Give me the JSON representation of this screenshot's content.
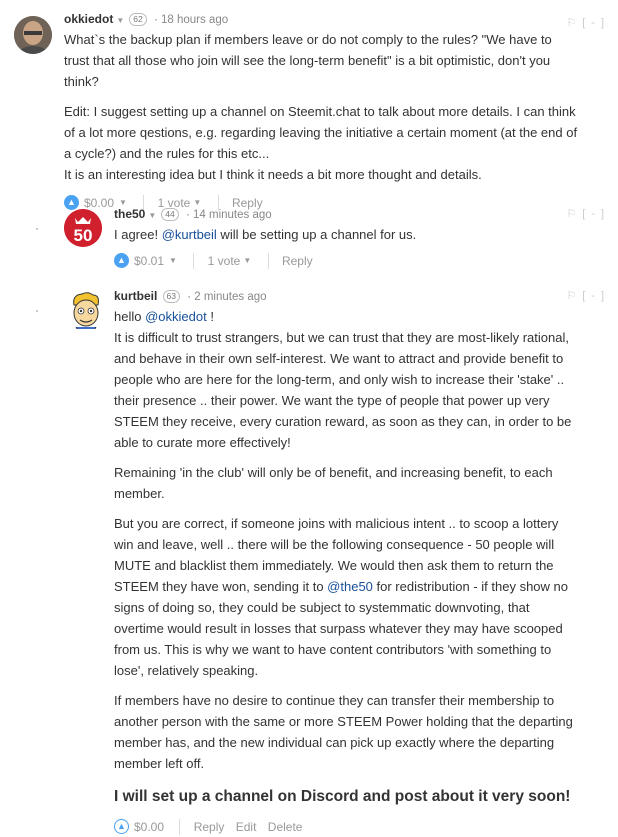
{
  "comments": [
    {
      "author": "okkiedot",
      "reputation": "62",
      "time": "18 hours ago",
      "collapse": "[-]",
      "paragraphs": [
        "What`s the backup plan if members leave or do not comply to the rules? \"We have to trust that all those who join will see the long-term benefit\" is a bit optimistic, don't you think?",
        "Edit: I suggest setting up a channel on Steemit.chat to talk about more details. I can think of a lot more qestions, e.g. regarding leaving the initiative a certain moment (at the end of a cycle?) and the rules for this etc...\nIt is an interesting idea but I think it needs a bit more thought and details."
      ],
      "payout": "$0.00",
      "votes": "1 vote",
      "reply": "Reply"
    },
    {
      "author": "the50",
      "reputation": "44",
      "time": "14 minutes ago",
      "collapse": "[-]",
      "avatar_text": "50",
      "text_before": "I agree! ",
      "mention": "@kurtbeil",
      "text_after": " will be setting up a channel for us.",
      "payout": "$0.01",
      "votes": "1 vote",
      "reply": "Reply"
    },
    {
      "author": "kurtbeil",
      "reputation": "63",
      "time": "2 minutes ago",
      "collapse": "[-]",
      "greeting_before": "hello ",
      "greeting_mention": "@okkiedot",
      "greeting_after": " !",
      "p1": "It is difficult to trust strangers, but we can trust that they are most-likely rational, and behave in their own self-interest. We want to attract and provide benefit to people who are here for the long-term, and only wish to increase their 'stake' .. their presence .. their power. We want the type of people that power up very STEEM they receive, every curation reward, as soon as they can, in order to be able to curate more effectively!",
      "p2": "Remaining 'in the club' will only be of benefit, and increasing benefit, to each member.",
      "p3_before": "But you are correct, if someone joins with malicious intent .. to scoop a lottery win and leave, well .. there will be the following consequence - 50 people will MUTE and blacklist them immediately. We would then ask them to return the STEEM they have won, sending it to ",
      "p3_mention": "@the50",
      "p3_after": " for redistribution - if they show no signs of doing so, they could be subject to systemmatic downvoting, that overtime would result in losses that surpass whatever they may have scooped from us. This is why we want to have content contributors 'with something to lose', relatively speaking.",
      "p4": "If members have no desire to continue they can transfer their membership to another person with the same or more STEEM Power holding that the departing member has, and the new individual can pick up exactly where the departing member left off.",
      "p5": "I will set up a channel on Discord and post about it very soon!",
      "payout": "$0.00",
      "reply": "Reply",
      "edit": "Edit",
      "delete": "Delete"
    }
  ],
  "colors": {
    "accent": "#4ba2f2",
    "mention": "#1a5099",
    "the50_red": "#d0202e"
  },
  "icons": [
    "flag-icon",
    "upvote-icon",
    "chevron-down-icon"
  ]
}
